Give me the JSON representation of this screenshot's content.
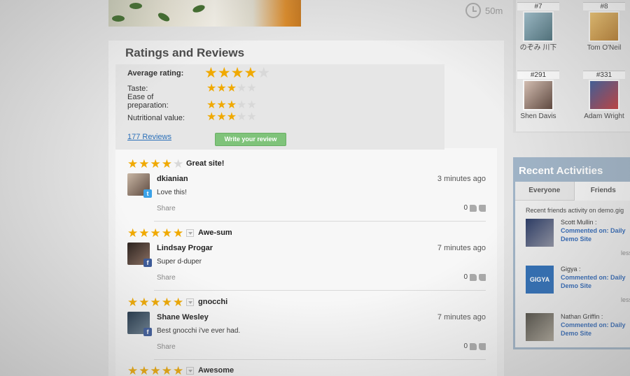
{
  "recipe": {
    "time": "50m"
  },
  "ratings": {
    "title": "Ratings and Reviews",
    "average_label": "Average rating:",
    "average": 4,
    "categories": [
      {
        "label": "Taste:",
        "value": 3
      },
      {
        "label": "Ease of preparation:",
        "value": 3
      },
      {
        "label": "Nutritional value:",
        "value": 3
      }
    ],
    "reviews_link": "177 Reviews",
    "write_button": "Write your review"
  },
  "reviews": [
    {
      "stars": 4,
      "title": "Great site!",
      "user": "dkianian",
      "network": "twitter",
      "time": "3 minutes ago",
      "text": "Love this!",
      "share": "Share",
      "votes": "0",
      "avatar_color": "#7c6a62"
    },
    {
      "stars": 5,
      "title": "Awe-sum",
      "user": "Lindsay Progar",
      "network": "facebook",
      "time": "7 minutes ago",
      "text": "Super d-duper",
      "share": "Share",
      "votes": "0",
      "avatar_color": "#4a3b35"
    },
    {
      "stars": 5,
      "title": "gnocchi",
      "user": "Shane Wesley",
      "network": "facebook",
      "time": "7 minutes ago",
      "text": "Best gnocchi i've ever had.",
      "share": "Share",
      "votes": "0",
      "avatar_color": "#2f4d6a"
    },
    {
      "stars": 5,
      "title": "Awesome"
    }
  ],
  "leaderboard": [
    {
      "rank": "#7",
      "name": "のぞみ 川下",
      "color": "#6a8f9c"
    },
    {
      "rank": "#8",
      "name": "Tom O'Neil",
      "color": "#d9a24a"
    },
    {
      "rank": "#291",
      "name": "Shen Davis",
      "color": "#8b6d63"
    },
    {
      "rank": "#331",
      "name": "Adam Wright",
      "color": "#a53a3a"
    }
  ],
  "activities": {
    "title": "Recent Activities",
    "tabs": [
      "Everyone",
      "Friends"
    ],
    "subtitle": "Recent friends activity on demo.gig",
    "items": [
      {
        "name": "Scott Mullin :",
        "link1": "Commented on: Daily",
        "link2": "Demo Site",
        "less": "less",
        "color": "#3c4b73"
      },
      {
        "name": "Gigya :",
        "link1": "Commented on: Daily",
        "link2": "Demo Site",
        "less": "less",
        "color": "#2d6db5",
        "logo": "GIGYA"
      },
      {
        "name": "Nathan Griffin :",
        "link1": "Commented on: Daily",
        "link2": "Demo Site",
        "color": "#6c6a5e"
      }
    ]
  }
}
